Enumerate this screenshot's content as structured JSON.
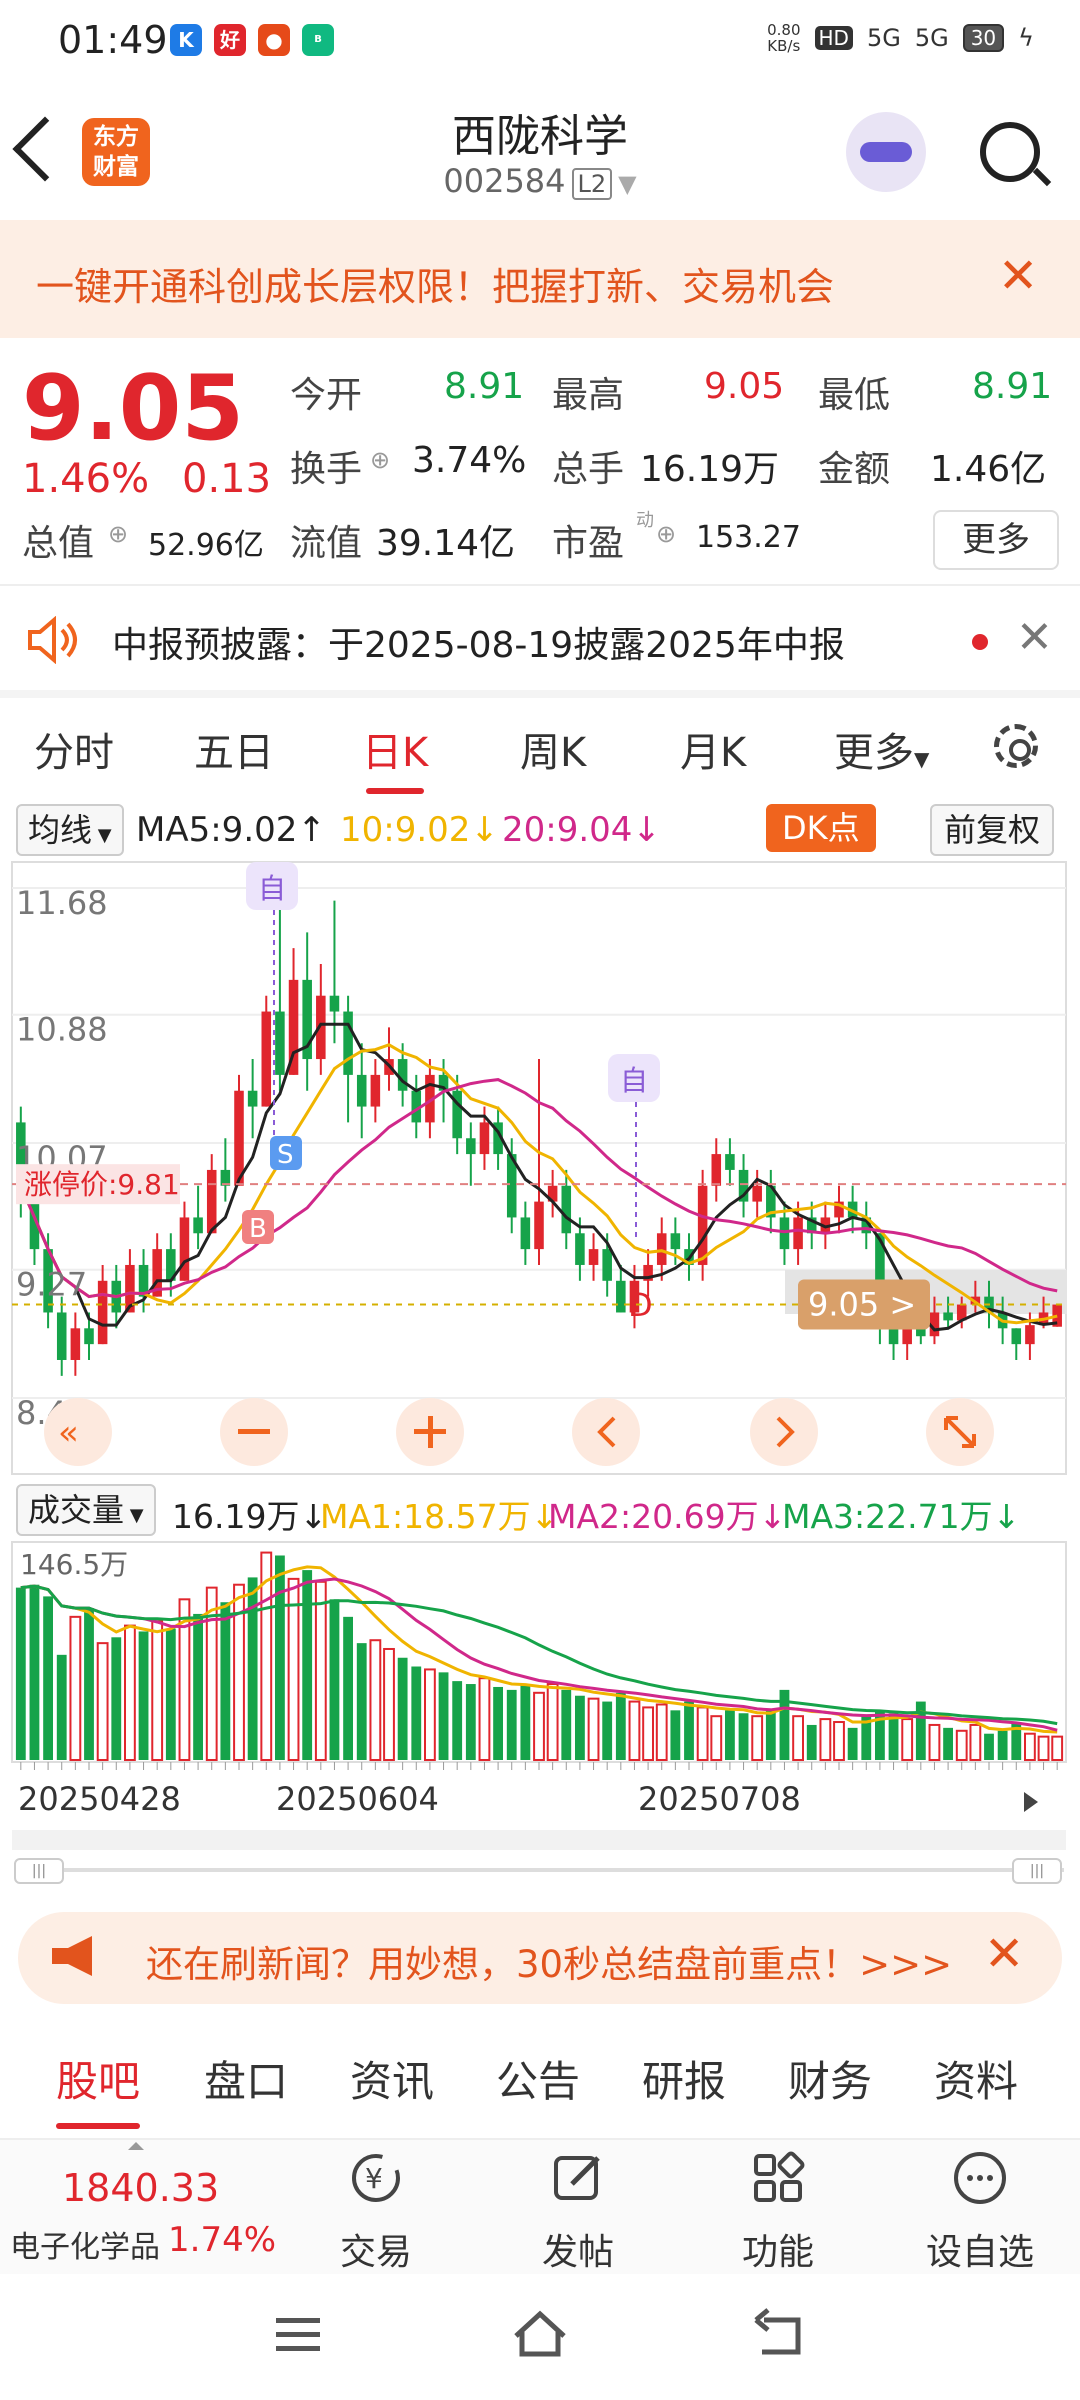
{
  "status": {
    "time": "01:49",
    "net_speed": "0.80\nKB/s",
    "net_top": "0.80",
    "net_bottom": "KB/s",
    "hd": "HD",
    "sig1": "5G",
    "sig2": "5G",
    "battery": "30"
  },
  "header": {
    "logo_line1": "东方",
    "logo_line2": "财富",
    "stock_name": "西陇科学",
    "stock_code": "002584",
    "level": "L2"
  },
  "promo": {
    "text": "一键开通科创成长层权限！把握打新、交易机会",
    "close": "✕"
  },
  "quote": {
    "price": "9.05",
    "change_pct": "1.46%",
    "change": "0.13",
    "open_label": "今开",
    "open": "8.91",
    "high_label": "最高",
    "high": "9.05",
    "low_label": "最低",
    "low": "8.91",
    "turnover_label": "换手",
    "turnover": "3.74%",
    "volume_label": "总手",
    "volume": "16.19万",
    "amount_label": "金额",
    "amount": "1.46亿",
    "mktcap_label": "总值",
    "mktcap": "52.96亿",
    "float_label": "流值",
    "float": "39.14亿",
    "pe_label": "市盈",
    "pe_sup": "动",
    "pe": "153.27",
    "more": "更多"
  },
  "notice": {
    "text": "中报预披露：于2025-08-19披露2025年中报",
    "close": "✕"
  },
  "kline_tabs": [
    "分时",
    "五日",
    "日K",
    "周K",
    "月K",
    "更多"
  ],
  "kline_active": 2,
  "ma_legend": {
    "selector": "均线",
    "ma5": "MA5:9.02↑",
    "ma10": "10:9.02↓",
    "ma20": "20:9.04↓",
    "dk": "DK点",
    "adjust": "前复权"
  },
  "colors": {
    "up": "#e0262d",
    "down": "#16a34a",
    "ma5": "#222222",
    "ma10": "#f0b400",
    "ma20": "#d0288a",
    "accent": "#f0641e"
  },
  "chart_data": [
    {
      "type": "candlestick",
      "y_ticks": [
        "11.68",
        "10.88",
        "10.07",
        "9.27",
        "8.46"
      ],
      "ylim": [
        8.46,
        11.68
      ],
      "limit_up_label": "涨停价:9.81",
      "limit_up": 9.81,
      "last_price_label": "9.05",
      "markers": {
        "B": "B",
        "S": "S",
        "D": "D",
        "self1": "自",
        "self2": "自"
      },
      "candles": [
        [
          10.2,
          9.8,
          10.3,
          9.6
        ],
        [
          9.8,
          9.4,
          9.9,
          9.3
        ],
        [
          9.4,
          9.0,
          9.5,
          8.9
        ],
        [
          9.0,
          8.7,
          9.1,
          8.6
        ],
        [
          8.7,
          8.9,
          9.0,
          8.6
        ],
        [
          8.9,
          8.8,
          9.0,
          8.7
        ],
        [
          8.8,
          9.2,
          9.3,
          8.8
        ],
        [
          9.2,
          9.0,
          9.3,
          8.9
        ],
        [
          9.0,
          9.3,
          9.4,
          9.0
        ],
        [
          9.3,
          9.1,
          9.4,
          9.0
        ],
        [
          9.1,
          9.4,
          9.5,
          9.1
        ],
        [
          9.4,
          9.2,
          9.5,
          9.1
        ],
        [
          9.2,
          9.6,
          9.7,
          9.2
        ],
        [
          9.6,
          9.5,
          9.8,
          9.4
        ],
        [
          9.5,
          9.9,
          10.0,
          9.5
        ],
        [
          9.9,
          9.8,
          10.1,
          9.7
        ],
        [
          9.8,
          10.4,
          10.5,
          9.8
        ],
        [
          10.4,
          10.3,
          10.6,
          10.1
        ],
        [
          10.3,
          10.9,
          11.0,
          10.3
        ],
        [
          10.9,
          10.5,
          11.7,
          10.4
        ],
        [
          10.5,
          11.1,
          11.3,
          10.5
        ],
        [
          11.1,
          10.6,
          11.4,
          10.4
        ],
        [
          10.6,
          11.0,
          11.2,
          10.5
        ],
        [
          11.0,
          10.9,
          11.6,
          10.7
        ],
        [
          10.9,
          10.5,
          11.0,
          10.2
        ],
        [
          10.5,
          10.3,
          10.7,
          10.1
        ],
        [
          10.3,
          10.5,
          10.6,
          10.2
        ],
        [
          10.5,
          10.6,
          10.8,
          10.4
        ],
        [
          10.6,
          10.4,
          10.7,
          10.3
        ],
        [
          10.4,
          10.2,
          10.5,
          10.1
        ],
        [
          10.2,
          10.5,
          10.6,
          10.1
        ],
        [
          10.5,
          10.4,
          10.6,
          10.2
        ],
        [
          10.4,
          10.1,
          10.5,
          10.0
        ],
        [
          10.1,
          10.0,
          10.2,
          9.8
        ],
        [
          10.0,
          10.2,
          10.3,
          9.9
        ],
        [
          10.2,
          10.0,
          10.3,
          9.9
        ],
        [
          10.0,
          9.6,
          10.1,
          9.5
        ],
        [
          9.6,
          9.4,
          9.7,
          9.3
        ],
        [
          9.4,
          9.7,
          10.6,
          9.3
        ],
        [
          9.7,
          9.8,
          9.9,
          9.6
        ],
        [
          9.8,
          9.5,
          9.9,
          9.4
        ],
        [
          9.5,
          9.3,
          9.6,
          9.2
        ],
        [
          9.3,
          9.4,
          9.5,
          9.2
        ],
        [
          9.4,
          9.2,
          9.5,
          9.1
        ],
        [
          9.2,
          9.0,
          9.3,
          9.0
        ],
        [
          9.0,
          9.2,
          9.3,
          8.9
        ],
        [
          9.2,
          9.3,
          9.4,
          9.1
        ],
        [
          9.3,
          9.5,
          9.6,
          9.2
        ],
        [
          9.5,
          9.4,
          9.6,
          9.3
        ],
        [
          9.4,
          9.3,
          9.5,
          9.2
        ],
        [
          9.3,
          9.8,
          9.9,
          9.2
        ],
        [
          9.8,
          10.0,
          10.1,
          9.7
        ],
        [
          10.0,
          9.9,
          10.1,
          9.8
        ],
        [
          9.9,
          9.7,
          10.0,
          9.6
        ],
        [
          9.7,
          9.8,
          9.9,
          9.6
        ],
        [
          9.8,
          9.6,
          9.9,
          9.5
        ],
        [
          9.6,
          9.4,
          9.7,
          9.3
        ],
        [
          9.4,
          9.6,
          9.7,
          9.3
        ],
        [
          9.6,
          9.5,
          9.7,
          9.4
        ],
        [
          9.5,
          9.6,
          9.7,
          9.4
        ],
        [
          9.6,
          9.7,
          9.8,
          9.5
        ],
        [
          9.7,
          9.6,
          9.8,
          9.5
        ],
        [
          9.6,
          9.5,
          9.7,
          9.4
        ],
        [
          9.5,
          8.9,
          9.5,
          8.8
        ],
        [
          8.9,
          8.8,
          9.0,
          8.7
        ],
        [
          8.8,
          8.9,
          9.0,
          8.7
        ],
        [
          8.9,
          8.85,
          9.0,
          8.8
        ],
        [
          8.85,
          9.0,
          9.1,
          8.8
        ],
        [
          9.0,
          8.95,
          9.1,
          8.9
        ],
        [
          8.95,
          9.05,
          9.1,
          8.9
        ],
        [
          9.05,
          9.1,
          9.2,
          9.0
        ],
        [
          9.1,
          9.0,
          9.2,
          8.9
        ],
        [
          9.0,
          8.9,
          9.1,
          8.8
        ],
        [
          8.9,
          8.8,
          8.9,
          8.7
        ],
        [
          8.8,
          8.92,
          9.0,
          8.7
        ],
        [
          8.92,
          9.0,
          9.1,
          8.9
        ],
        [
          8.91,
          9.05,
          9.05,
          8.91
        ]
      ]
    },
    {
      "type": "bar",
      "title": "成交量",
      "current": "16.19万↓",
      "ma1": "MA1:18.57万↓",
      "ma2": "MA2:20.69万↓",
      "ma3": "MA3:22.71万↓",
      "y_tick": "146.5万",
      "x_ticks": [
        "20250428",
        "20250604",
        "20250708"
      ],
      "values": [
        118,
        120,
        112,
        72,
        98,
        104,
        80,
        84,
        92,
        88,
        95,
        90,
        110,
        100,
        118,
        108,
        120,
        125,
        142,
        140,
        124,
        130,
        122,
        110,
        98,
        80,
        82,
        76,
        70,
        64,
        62,
        60,
        54,
        52,
        56,
        50,
        48,
        52,
        46,
        52,
        48,
        44,
        42,
        40,
        46,
        40,
        36,
        38,
        34,
        40,
        36,
        30,
        34,
        32,
        30,
        34,
        48,
        30,
        24,
        28,
        26,
        22,
        30,
        34,
        32,
        28,
        40,
        24,
        22,
        20,
        24,
        18,
        20,
        26,
        18,
        16,
        16
      ]
    }
  ],
  "scroll_handles": [
    "|||",
    "|||"
  ],
  "ad": {
    "text": "还在刷新闻？用妙想，30秒总结盘前重点！>>>",
    "close": "✕"
  },
  "bottom_tabs": [
    "股吧",
    "盘口",
    "资讯",
    "公告",
    "研报",
    "财务",
    "资料"
  ],
  "bottom_active": 0,
  "index": {
    "value": "1840.33",
    "name": "电子化学品",
    "pct": "1.74%"
  },
  "bottombar": {
    "trade": "交易",
    "post": "发帖",
    "func": "功能",
    "watch": "设自选"
  }
}
